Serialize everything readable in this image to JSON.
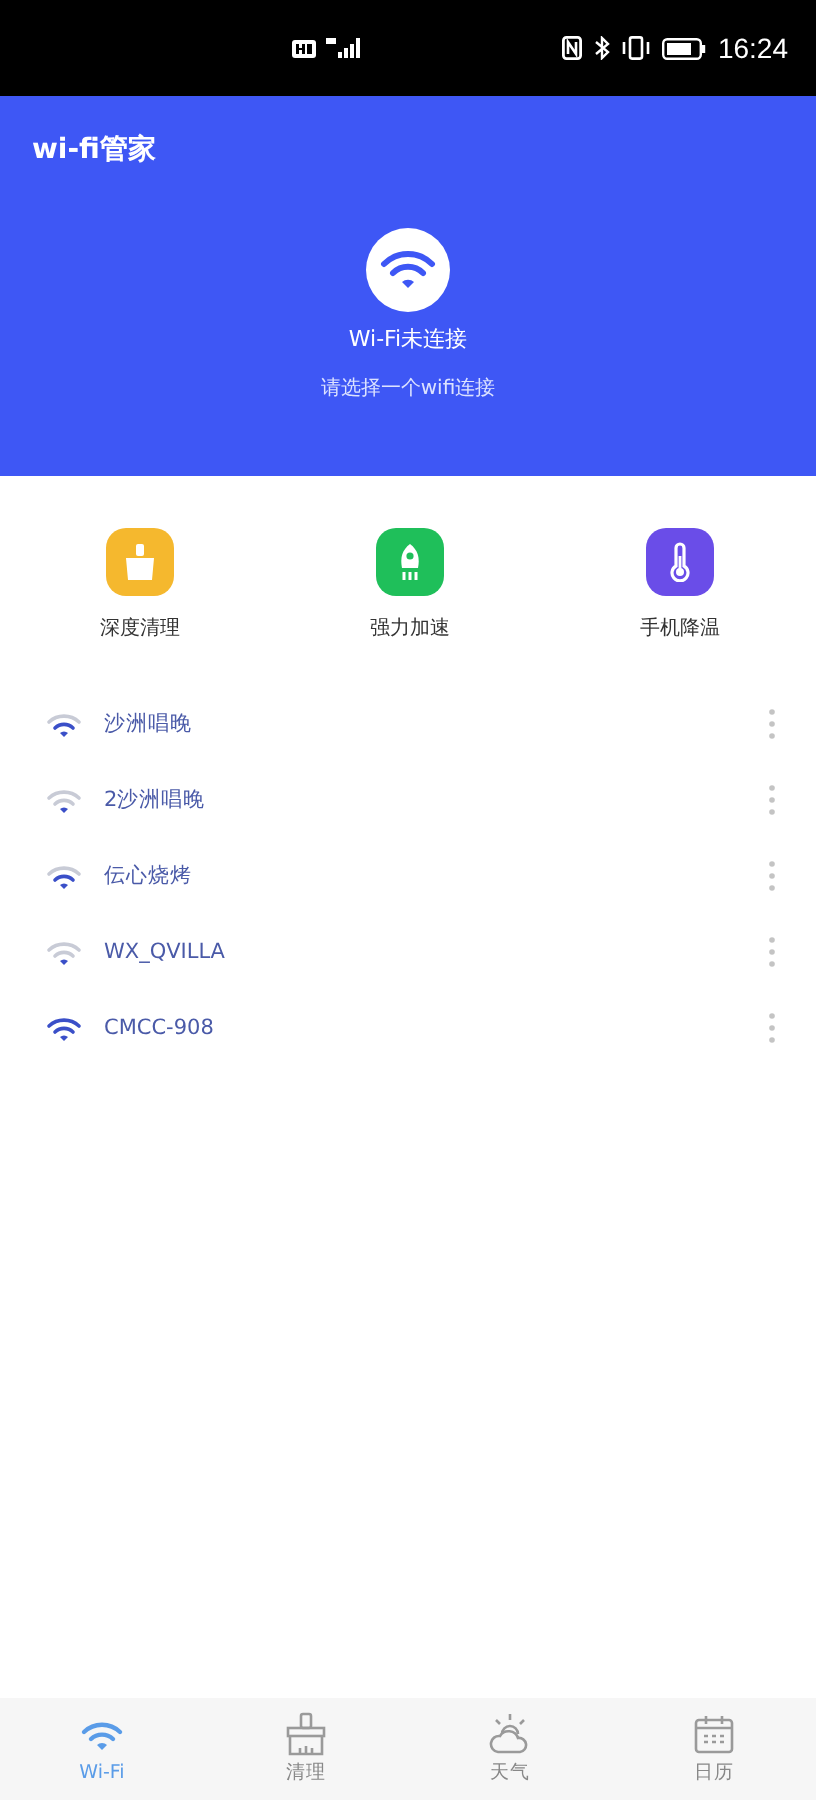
{
  "status_bar": {
    "time": "16:24"
  },
  "header": {
    "title": "wi-fi管家",
    "status": "Wi-Fi未连接",
    "hint": "请选择一个wifi连接"
  },
  "tools": [
    {
      "label": "深度清理",
      "kind": "broom",
      "color": "#f5b82e"
    },
    {
      "label": "强力加速",
      "kind": "rocket",
      "color": "#1fbf5a"
    },
    {
      "label": "手机降温",
      "kind": "thermometer",
      "color": "#6a4de8"
    }
  ],
  "networks": [
    {
      "name": "沙洲唱晚",
      "kind": "medium"
    },
    {
      "name": "2沙洲唱晚",
      "kind": "weak"
    },
    {
      "name": "伝心烧烤",
      "kind": "medium"
    },
    {
      "name": "WX_QVILLA",
      "kind": "weak"
    },
    {
      "name": "CMCC-908",
      "kind": "full"
    }
  ],
  "nav": [
    {
      "label": "Wi-Fi",
      "kind": "wifi",
      "selected": true
    },
    {
      "label": "清理",
      "kind": "broom",
      "selected": false
    },
    {
      "label": "天气",
      "kind": "weather",
      "selected": false
    },
    {
      "label": "日历",
      "kind": "calendar",
      "selected": false
    }
  ]
}
